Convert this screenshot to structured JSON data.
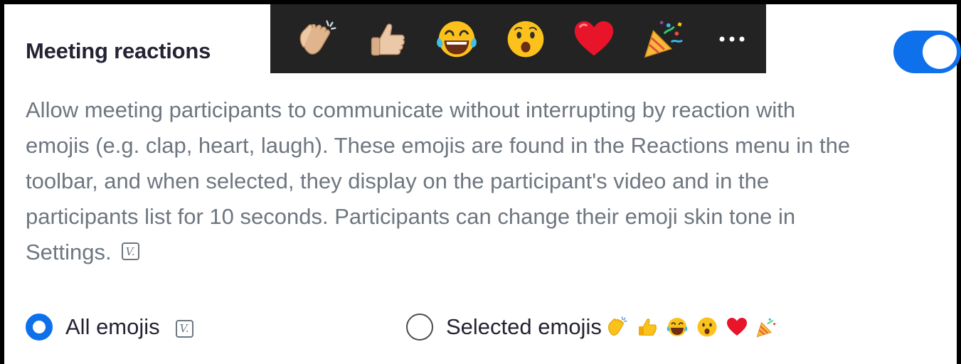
{
  "setting": {
    "title": "Meeting reactions",
    "description": "Allow meeting participants to communicate without interrupting by reaction with emojis (e.g. clap, heart, laugh). These emojis are found in the Reactions menu in the toolbar, and when selected, they display on the participant's video and in the participants list for 10 seconds. Participants can change their emoji skin tone in Settings.",
    "badge_label": "V.",
    "enabled": true
  },
  "toolbar": {
    "emojis": [
      "clap",
      "thumbs-up",
      "tears-of-joy",
      "open-mouth",
      "heart",
      "party-popper"
    ],
    "more_icon": "more-horizontal-icon"
  },
  "options": {
    "all_label": "All emojis",
    "all_badge": "V.",
    "selected_label": "Selected emojis",
    "selected_value": "all"
  },
  "colors": {
    "accent": "#0e71eb",
    "toolbar_bg": "#232323",
    "title": "#232333",
    "description": "#6e7680"
  }
}
